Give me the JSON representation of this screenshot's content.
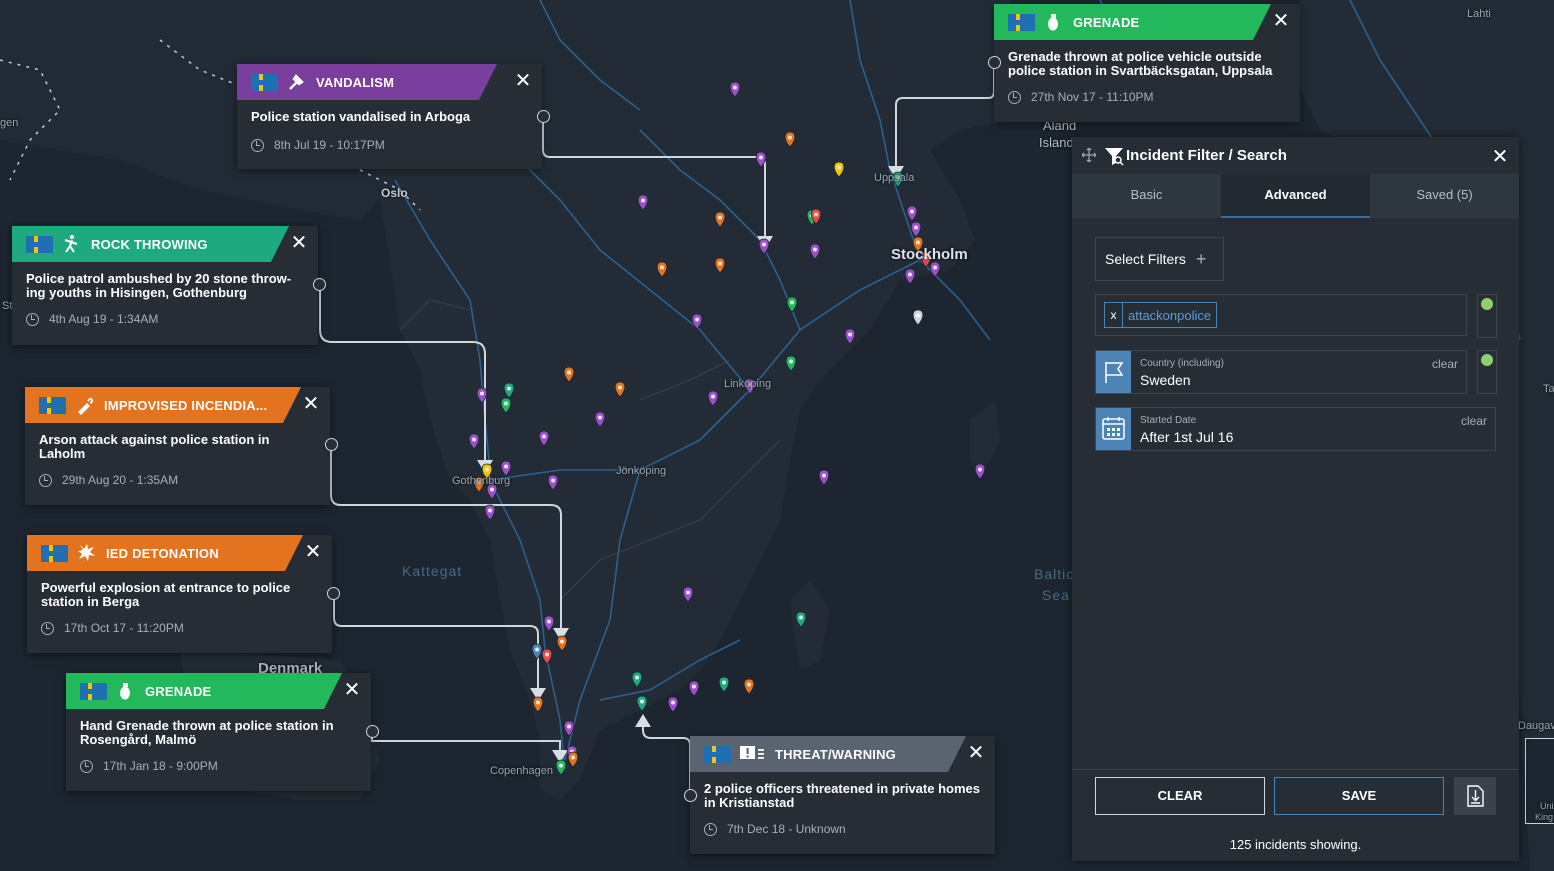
{
  "map": {
    "labels": {
      "oslo": "Oslo",
      "stockholm": "Stockholm",
      "uppsala": "Uppsala",
      "linkoping": "Linköping",
      "jonkoping": "Jönköping",
      "gothenburg": "Gothenburg",
      "copenhagen": "Copenhagen",
      "kattegat": "Kattegat",
      "baltic1": "Baltic",
      "baltic2": "Sea",
      "aland1": "Aland",
      "aland2": "Islands",
      "lahti": "Lahti",
      "denmark": "Denmark",
      "bergen_fragment": "gen",
      "edge_st": "St",
      "edge_ta": "Ta",
      "daugav": "Daugav",
      "uk1": "Uni",
      "uk2": "King"
    }
  },
  "cards": [
    {
      "id": "vandalism",
      "type_label": "VANDALISM",
      "color": "#7a3e9d",
      "icon": "hammer-icon",
      "description": "Police station vandalised in Arboga",
      "time": "8th Jul 19 - 10:17PM"
    },
    {
      "id": "rock",
      "type_label": "ROCK THROWING",
      "color": "#1fa97e",
      "icon": "rock-thrower-icon",
      "description": "Police patrol ambushed by 20 stone throw-ing youths in Hisingen, Gothenburg",
      "time": "4th Aug 19 - 1:34AM"
    },
    {
      "id": "incendiary",
      "type_label": "IMPROVISED INCENDIA...",
      "color": "#e3731e",
      "icon": "molotov-icon",
      "description": "Arson attack against police station in Laholm",
      "time": "29th Aug 20 - 1:35AM"
    },
    {
      "id": "ied",
      "type_label": "IED DETONATION",
      "color": "#e3731e",
      "icon": "explosion-icon",
      "description": "Powerful explosion at entrance to police station in Berga",
      "time": "17th Oct 17 - 11:20PM"
    },
    {
      "id": "grenade_malmo",
      "type_label": "GRENADE",
      "color": "#22b85b",
      "icon": "grenade-icon",
      "description": "Hand Grenade thrown at police station in Rosengård, Malmö",
      "time": "17th Jan 18 - 9:00PM"
    },
    {
      "id": "grenade_uppsala",
      "type_label": "GRENADE",
      "color": "#22b85b",
      "icon": "grenade-icon",
      "description": "Grenade thrown at police vehicle outside police station in Svartbäcksgatan, Uppsala",
      "time": "27th Nov 17 - 11:10PM"
    },
    {
      "id": "threat",
      "type_label": "THREAT/WARNING",
      "color": "#5a6470",
      "icon": "warning-message-icon",
      "description": "2 police officers threatened in private homes in Kristianstad",
      "time": "7th Dec 18 - Unknown"
    }
  ],
  "panel": {
    "title": "Incident Filter / Search",
    "tabs": [
      "Basic",
      "Advanced",
      "Saved (5)"
    ],
    "active_tab": "Advanced",
    "select_filters": "Select Filters",
    "tag_value": "attackonpolice",
    "tag_remove": "x",
    "country_label": "Country (including)",
    "country_value": "Sweden",
    "date_label": "Started Date",
    "date_value": "After 1st Jul 16",
    "clear_link": "clear",
    "clear_button": "CLEAR",
    "save_button": "SAVE",
    "count_text": "125 incidents showing.",
    "toggle_color": "#8ed16a",
    "accent": "#4d84b6"
  },
  "close_glyph": "✕",
  "plus_glyph": "+"
}
